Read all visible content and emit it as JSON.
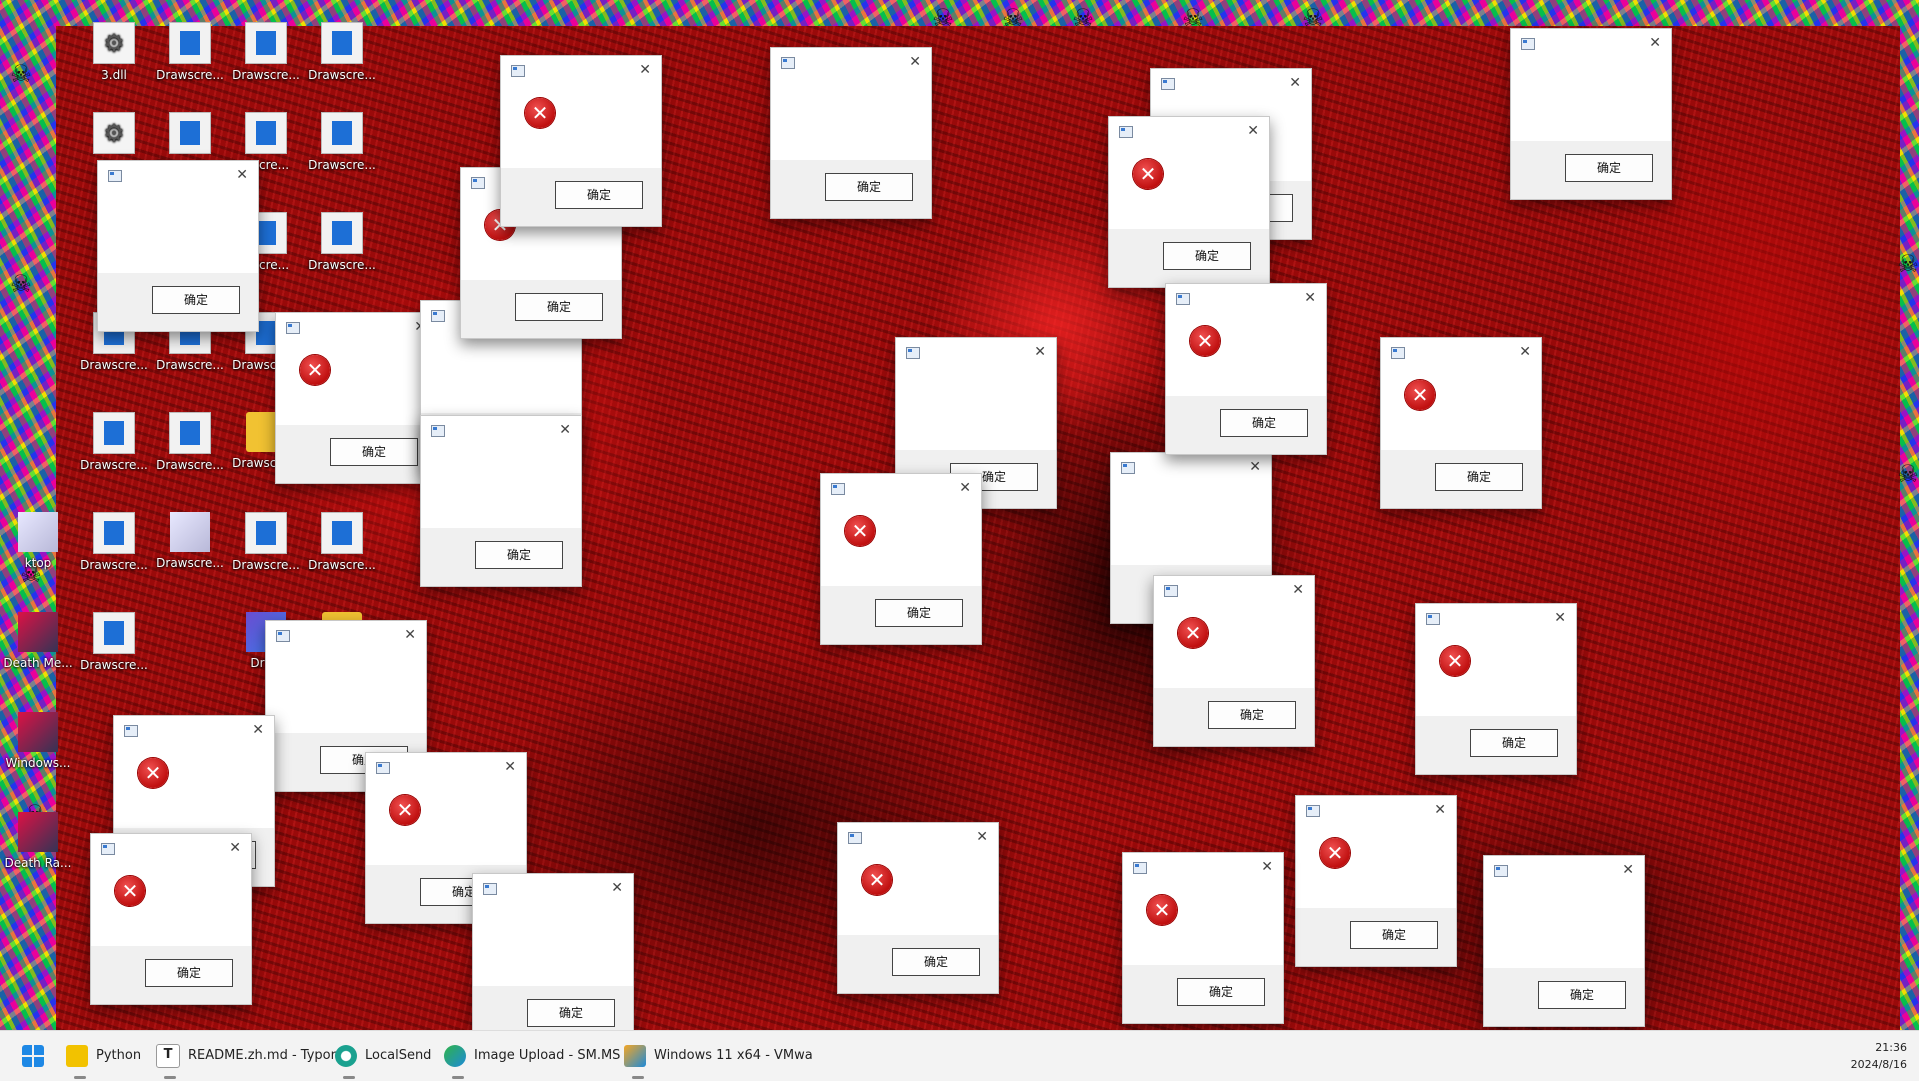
{
  "desktop": {
    "icons": [
      {
        "label": "3.dll",
        "kind": "gear"
      },
      {
        "label": "Drawscre...",
        "kind": "app"
      },
      {
        "label": "Drawscre...",
        "kind": "app"
      },
      {
        "label": "Drawscre...",
        "kind": "app"
      },
      {
        "label": "",
        "kind": "gear"
      },
      {
        "label": "Drawscre...",
        "kind": "app"
      },
      {
        "label": "wscre...",
        "kind": "app"
      },
      {
        "label": "Drawscre...",
        "kind": "app"
      },
      {
        "label": "wscre...",
        "kind": "app"
      },
      {
        "label": "Drawscre...",
        "kind": "app"
      },
      {
        "label": "Drawscre...",
        "kind": "app"
      },
      {
        "label": "Drawscre...",
        "kind": "app"
      },
      {
        "label": "Drawscre...",
        "kind": "app"
      },
      {
        "label": "Drawscre...",
        "kind": "app"
      },
      {
        "label": "Drawscre...",
        "kind": "folder"
      },
      {
        "label": "Drawscre...",
        "kind": "app"
      },
      {
        "label": "Drawscre...",
        "kind": "app"
      },
      {
        "label": "Drawscre...",
        "kind": "anime"
      },
      {
        "label": "Drawscre...",
        "kind": "app"
      },
      {
        "label": "Drawscre...",
        "kind": "app"
      },
      {
        "label": "Drawscre...",
        "kind": "app"
      },
      {
        "label": "Draw",
        "kind": "win"
      },
      {
        "label": "Drawscre",
        "kind": "folder"
      },
      {
        "label": "Death Me...",
        "kind": "game"
      },
      {
        "label": "Windows...",
        "kind": "game"
      },
      {
        "label": "Death Ra...",
        "kind": "game"
      },
      {
        "label": "ktop",
        "kind": "anime"
      }
    ]
  },
  "dialogs": {
    "ok_label": "确定",
    "close_glyph": "✕",
    "error_glyph": "✕"
  },
  "taskbar": {
    "items": [
      {
        "label": "Python",
        "icon": "folder-icon",
        "color": "#f2c200"
      },
      {
        "label": "README.zh.md - Typora",
        "icon": "typora-icon",
        "color": "#333333"
      },
      {
        "label": "LocalSend",
        "icon": "localsend-icon",
        "color": "#1aa18f"
      },
      {
        "label": "Image Upload - SM.MS",
        "icon": "edge-icon",
        "color": "#2fb34a"
      },
      {
        "label": "Windows 11 x64 - VMwa",
        "icon": "vmware-icon",
        "color": "#1d8ad8"
      }
    ],
    "time": "21:36",
    "date": "2024/8/16"
  },
  "colors": {
    "wallpaper": "#9a0a0a",
    "error_red": "#c01010",
    "taskbar": "#f3f3f3"
  }
}
